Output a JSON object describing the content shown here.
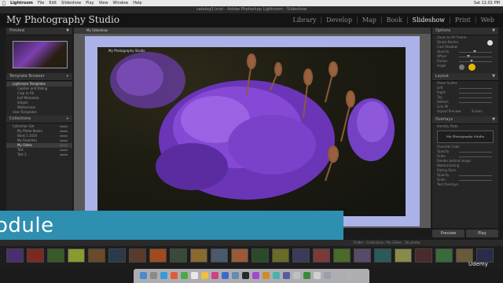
{
  "menubar": {
    "app_name": "Lightroom",
    "items": [
      "File",
      "Edit",
      "Slideshow",
      "Play",
      "View",
      "Window",
      "Help"
    ],
    "clock": "Sat 11:01 PM"
  },
  "window_title": "catalog3.lrcat - Adobe Photoshop Lightroom - Slideshow",
  "identity_plate": "My Photography Studio",
  "modules": [
    {
      "label": "Library",
      "active": false
    },
    {
      "label": "Develop",
      "active": false
    },
    {
      "label": "Map",
      "active": false
    },
    {
      "label": "Book",
      "active": false
    },
    {
      "label": "Slideshow",
      "active": true
    },
    {
      "label": "Print",
      "active": false
    },
    {
      "label": "Web",
      "active": false
    }
  ],
  "left_panel": {
    "preview_title": "Preview",
    "template_title": "Template Browser",
    "templates": [
      "Lightroom Templates",
      "Caption and Rating",
      "Crop to Fill",
      "Exif Metadata",
      "Simple",
      "Widescreen",
      "User Templates"
    ],
    "collections_title": "Collections",
    "collections": [
      "Collection Set",
      "My Photo Books",
      "Book 1 2016",
      "My Favorites",
      "My Slides",
      "Test",
      "Test 2"
    ]
  },
  "center": {
    "title": "My Slideshow",
    "overlay_text": "My Photography Studio"
  },
  "right_panel": {
    "options_title": "Options",
    "options_rows": [
      "Zoom to Fill Frame",
      "Stroke Border",
      "Cast Shadow",
      "Opacity",
      "Offset",
      "Radius",
      "Angle"
    ],
    "layout_title": "Layout",
    "layout_rows": [
      "Show Guides",
      "Left",
      "Right",
      "Top",
      "Bottom",
      "Link All"
    ],
    "aspect_preview": "Aspect Preview",
    "screen": "Screen",
    "overlays_title": "Overlays",
    "overlays_rows": [
      "Identity Plate",
      "Override Color",
      "Opacity",
      "Scale",
      "Render behind image",
      "Watermarking",
      "Rating Stars",
      "Opacity",
      "Scale",
      "Text Overlays"
    ],
    "plate_text": "My Photography Studio"
  },
  "buttons": {
    "preview": "Preview",
    "play": "Play"
  },
  "banner_text": "odule",
  "filmstrip": {
    "status": "Folder - Collections / My Slides - 26 photos"
  },
  "watermark": "Udemy"
}
